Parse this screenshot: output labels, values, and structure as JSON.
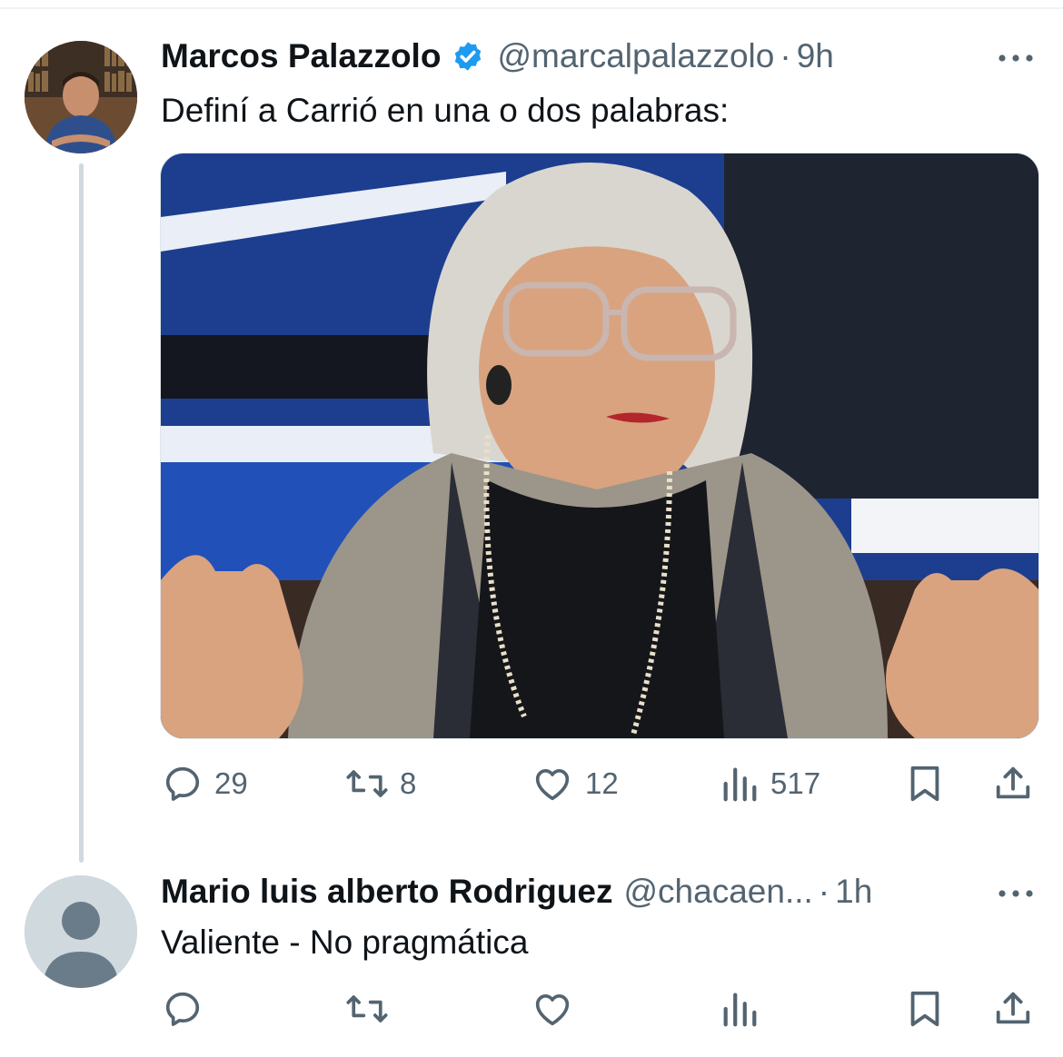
{
  "tweet": {
    "author_name": "Marcos Palazzolo",
    "handle": "@marcalpalazzolo",
    "separator": "·",
    "time": "9h",
    "text": "Definí a Carrió en una o dos palabras:",
    "stats": {
      "replies": "29",
      "reposts": "8",
      "likes": "12",
      "views": "517"
    },
    "verified_icon": "verified-badge-icon",
    "accent_color": "#1d9bf0"
  },
  "reply": {
    "author_name": "Mario luis alberto Rodriguez",
    "handle": "@chacaen...",
    "separator": "·",
    "time": "1h",
    "text": "Valiente - No pragmática"
  },
  "icons": [
    "more-icon",
    "reply-icon",
    "repost-icon",
    "like-icon",
    "views-icon",
    "bookmark-icon",
    "share-icon"
  ]
}
